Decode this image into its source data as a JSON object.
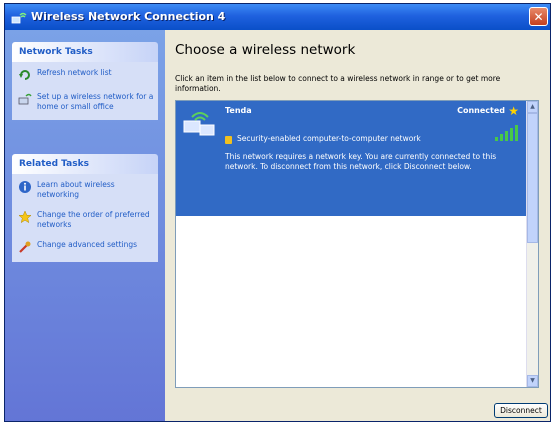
{
  "window": {
    "title": "Wireless Network Connection 4"
  },
  "sidebar": {
    "network_tasks": {
      "header": "Network Tasks",
      "items": [
        {
          "label": "Refresh network list",
          "icon": "refresh-icon"
        },
        {
          "label": "Set up a wireless network for a home or small office",
          "icon": "setup-network-icon"
        }
      ]
    },
    "related_tasks": {
      "header": "Related Tasks",
      "items": [
        {
          "label": "Learn about wireless networking",
          "icon": "info-icon"
        },
        {
          "label": "Change the order of preferred networks",
          "icon": "star-icon"
        },
        {
          "label": "Change advanced settings",
          "icon": "settings-icon"
        }
      ]
    }
  },
  "main": {
    "heading": "Choose a wireless network",
    "instructions": "Click an item in the list below to connect to a wireless network in range or to get more information.",
    "networks": [
      {
        "name": "Tenda",
        "status": "Connected",
        "security": "Security-enabled computer-to-computer network",
        "description": "This network requires a network key. You are currently connected to this network. To disconnect from this network, click Disconnect below.",
        "signal_bars": 4
      }
    ],
    "disconnect_label": "Disconnect"
  },
  "colors": {
    "selection": "#316ac5",
    "titlebar": "#0a4fc8",
    "sidebar": "#6375d6",
    "link": "#215dc6"
  }
}
